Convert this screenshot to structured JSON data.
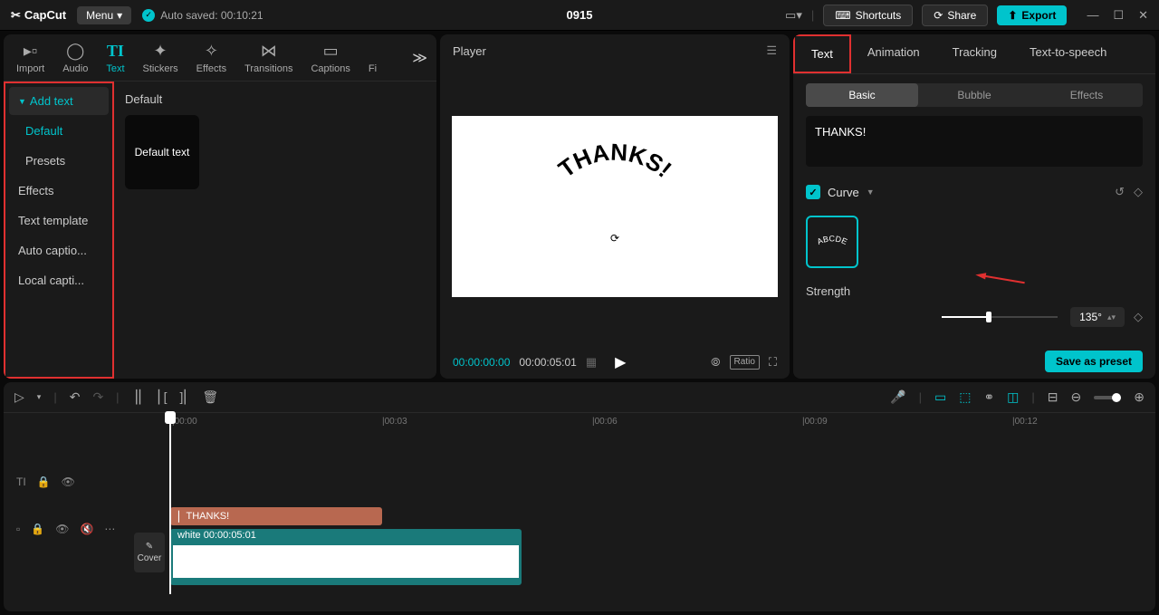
{
  "titleBar": {
    "logo": "CapCut",
    "menu": "Menu",
    "autosave": "Auto saved: 00:10:21",
    "projectName": "0915",
    "shortcuts": "Shortcuts",
    "share": "Share",
    "export": "Export"
  },
  "mediaTabs": {
    "import": "Import",
    "audio": "Audio",
    "text": "Text",
    "stickers": "Stickers",
    "effects": "Effects",
    "transitions": "Transitions",
    "captions": "Captions",
    "filters": "Fi"
  },
  "sidebar": {
    "addText": "Add text",
    "default": "Default",
    "presets": "Presets",
    "effects": "Effects",
    "textTemplate": "Text template",
    "autoCaptions": "Auto captio...",
    "localCaptions": "Local capti..."
  },
  "library": {
    "header": "Default",
    "defaultText": "Default text"
  },
  "player": {
    "title": "Player",
    "canvasText": "THANKS!",
    "timecode1": "00:00:00:00",
    "timecode2": "00:00:05:01",
    "ratio": "Ratio"
  },
  "propTabs": {
    "text": "Text",
    "animation": "Animation",
    "tracking": "Tracking",
    "tts": "Text-to-speech"
  },
  "subTabs": {
    "basic": "Basic",
    "bubble": "Bubble",
    "effects": "Effects"
  },
  "textPanel": {
    "content": "THANKS!",
    "curve": "Curve",
    "curvePreview": "ABCDE",
    "strength": "Strength",
    "angle": "135°",
    "savePreset": "Save as preset"
  },
  "timeline": {
    "marks": [
      "00:00",
      "00:03",
      "00:06",
      "00:09",
      "00:12"
    ],
    "textClip": "THANKS!",
    "videoClip": "white  00:00:05:01",
    "cover": "Cover"
  }
}
